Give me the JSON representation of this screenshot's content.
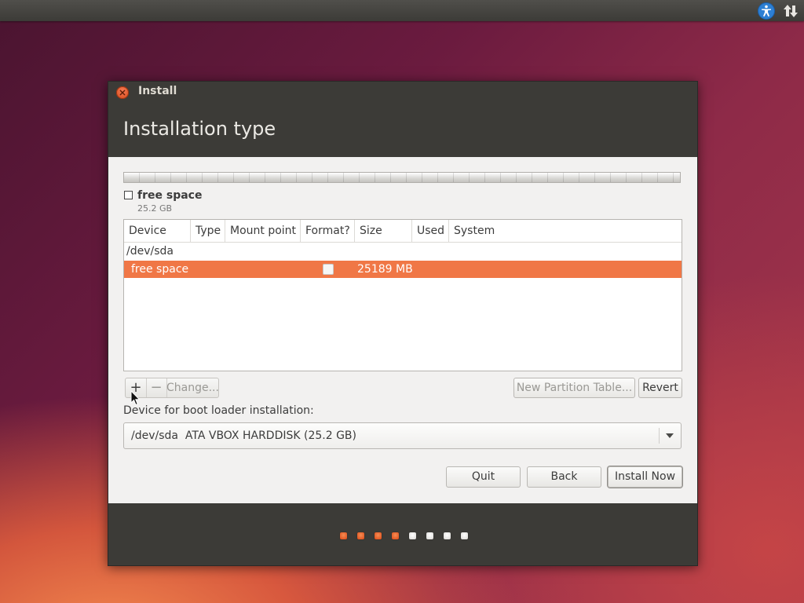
{
  "topbar": {
    "icons": [
      "accessibility-icon",
      "network-icon"
    ]
  },
  "window": {
    "title": "Install",
    "page_title": "Installation type"
  },
  "partition_bar": {
    "legend_label": "free space",
    "legend_size": "25.2 GB"
  },
  "table": {
    "columns": [
      "Device",
      "Type",
      "Mount point",
      "Format?",
      "Size",
      "Used",
      "System"
    ],
    "device_row": "/dev/sda",
    "selected_row": {
      "device": "free space",
      "format_checked": false,
      "size": "25189 MB"
    }
  },
  "tools": {
    "add_label": "+",
    "remove_label": "−",
    "change_label": "Change...",
    "new_table_label": "New Partition Table...",
    "revert_label": "Revert"
  },
  "bootloader": {
    "label": "Device for boot loader installation:",
    "selected": "/dev/sda  ATA VBOX HARDDISK (25.2 GB)"
  },
  "actions": {
    "quit_label": "Quit",
    "back_label": "Back",
    "install_label": "Install Now"
  },
  "progress": {
    "total_steps": 8,
    "completed_steps": 4
  },
  "colors": {
    "accent": "#f07746",
    "header_bg": "#3c3b37",
    "body_bg": "#f2f1f0"
  }
}
